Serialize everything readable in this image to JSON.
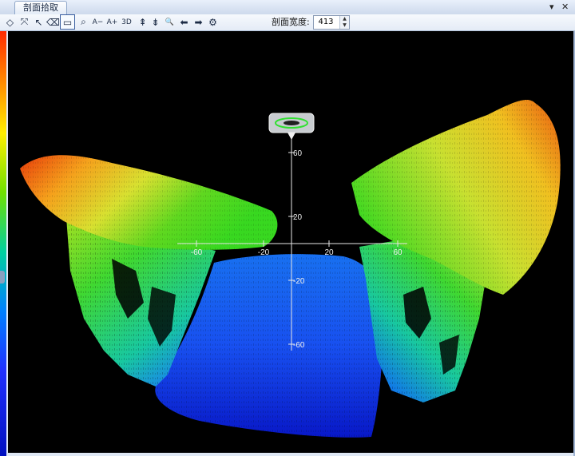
{
  "window": {
    "tab_title": "剖面拾取",
    "pin_icon": "dropdown-arrow-icon",
    "close_label": "✕"
  },
  "toolbar": {
    "buttons": [
      {
        "name": "rotate-icon",
        "glyph": "◇"
      },
      {
        "name": "fit-extent-icon",
        "glyph": "⤧"
      },
      {
        "name": "select-pointer-icon",
        "glyph": "↖"
      },
      {
        "name": "eraser-icon",
        "glyph": "⌫"
      },
      {
        "name": "rectangle-select-icon",
        "glyph": "▭"
      },
      {
        "name": "zoom-tool-icon",
        "glyph": "⌕"
      },
      {
        "name": "font-decrease-icon",
        "glyph": "A−"
      },
      {
        "name": "font-increase-icon",
        "glyph": "A+"
      },
      {
        "name": "view-3d-icon",
        "glyph": "3D"
      },
      {
        "name": "align-top-icon",
        "glyph": "⇞"
      },
      {
        "name": "align-bottom-icon",
        "glyph": "⇟"
      },
      {
        "name": "search-icon",
        "glyph": "🔍"
      },
      {
        "name": "arrow-left-icon",
        "glyph": "⬅"
      },
      {
        "name": "arrow-right-icon",
        "glyph": "➡"
      },
      {
        "name": "settings-gear-icon",
        "glyph": "⚙"
      }
    ],
    "width_label": "剖面宽度:",
    "width_value": "413"
  },
  "plot": {
    "x_ticks": [
      "-60",
      "-20",
      "20",
      "60"
    ],
    "y_ticks": [
      "60",
      "20",
      "-20",
      "-60"
    ],
    "colors": {
      "red": "#e83c0a",
      "orange": "#f5a21c",
      "yellow": "#e8e838",
      "green": "#38d820",
      "teal": "#18c8a0",
      "blue": "#1850f0",
      "deep_blue": "#0818c8"
    }
  }
}
